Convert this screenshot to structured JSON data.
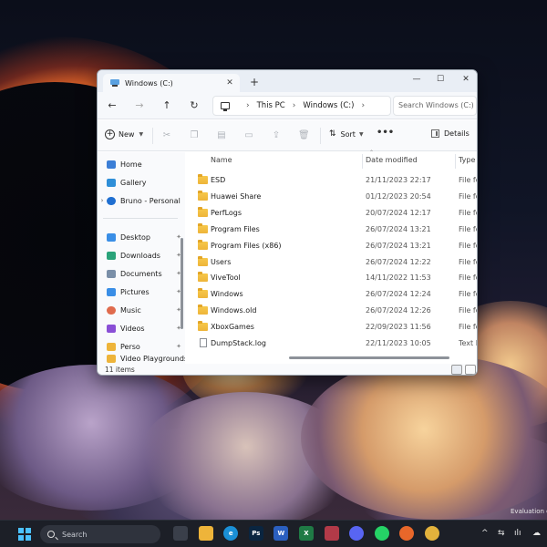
{
  "desktop": {
    "watermark": "Evaluation c"
  },
  "window": {
    "tab_title": "Windows (C:)",
    "new_tab": "+",
    "controls": {
      "minimize": "—",
      "maximize": "☐",
      "close": "✕"
    },
    "nav": {
      "back": "←",
      "forward": "→",
      "up": "↑",
      "refresh": "↻"
    },
    "breadcrumb": [
      "This PC",
      "Windows (C:)"
    ],
    "breadcrumb_sep": "›",
    "search_placeholder": "Search Windows (C:)",
    "toolbar": {
      "new_label": "New",
      "sort_label": "Sort",
      "more_label": "•••",
      "details_label": "Details"
    },
    "sidebar": {
      "quick": [
        {
          "label": "Home",
          "icon": "home-icon",
          "color": "#3b7ed6"
        },
        {
          "label": "Gallery",
          "icon": "gallery-icon",
          "color": "#2f8fd8"
        },
        {
          "label": "Bruno - Personal",
          "icon": "onedrive-icon",
          "color": "#1f6fd1"
        }
      ],
      "pinned": [
        {
          "label": "Desktop",
          "icon": "desktop-icon",
          "color": "#3a8ee6"
        },
        {
          "label": "Downloads",
          "icon": "downloads-icon",
          "color": "#2aa37a"
        },
        {
          "label": "Documents",
          "icon": "documents-icon",
          "color": "#7a8fa8"
        },
        {
          "label": "Pictures",
          "icon": "pictures-icon",
          "color": "#3a8ee6"
        },
        {
          "label": "Music",
          "icon": "music-icon",
          "color": "#e06b4d"
        },
        {
          "label": "Videos",
          "icon": "videos-icon",
          "color": "#8a4fd6"
        },
        {
          "label": "Perso",
          "icon": "folder-icon",
          "color": "#eeb43a"
        },
        {
          "label": "Video Playgrounds",
          "icon": "folder-icon",
          "color": "#eeb43a"
        }
      ]
    },
    "columns": {
      "name": "Name",
      "date": "Date modified",
      "type": "Type"
    },
    "files": [
      {
        "name": "ESD",
        "date": "21/11/2023 22:17",
        "type": "File folder",
        "kind": "folder"
      },
      {
        "name": "Huawei Share",
        "date": "01/12/2023 20:54",
        "type": "File folder",
        "kind": "folder"
      },
      {
        "name": "PerfLogs",
        "date": "20/07/2024 12:17",
        "type": "File folder",
        "kind": "folder"
      },
      {
        "name": "Program Files",
        "date": "26/07/2024 13:21",
        "type": "File folder",
        "kind": "folder"
      },
      {
        "name": "Program Files (x86)",
        "date": "26/07/2024 13:21",
        "type": "File folder",
        "kind": "folder"
      },
      {
        "name": "Users",
        "date": "26/07/2024 12:22",
        "type": "File folder",
        "kind": "folder"
      },
      {
        "name": "ViveTool",
        "date": "14/11/2022 11:53",
        "type": "File folder",
        "kind": "folder"
      },
      {
        "name": "Windows",
        "date": "26/07/2024 12:24",
        "type": "File folder",
        "kind": "folder"
      },
      {
        "name": "Windows.old",
        "date": "26/07/2024 12:26",
        "type": "File folder",
        "kind": "folder"
      },
      {
        "name": "XboxGames",
        "date": "22/09/2023 11:56",
        "type": "File folder",
        "kind": "folder"
      },
      {
        "name": "DumpStack.log",
        "date": "22/11/2023 10:05",
        "type": "Text Document",
        "kind": "file"
      }
    ],
    "status": "11 items"
  },
  "taskbar": {
    "search_label": "Search",
    "apps": [
      {
        "name": "task-view",
        "color": "#3a3f4a",
        "glyph": ""
      },
      {
        "name": "file-explorer",
        "color": "#eeb43a",
        "glyph": ""
      },
      {
        "name": "edge",
        "color": "#1a8fd6",
        "glyph": "e"
      },
      {
        "name": "photoshop",
        "color": "#0a2540",
        "glyph": "Ps"
      },
      {
        "name": "word",
        "color": "#2b5fbf",
        "glyph": "W"
      },
      {
        "name": "excel",
        "color": "#1f7a45",
        "glyph": "X"
      },
      {
        "name": "app-store",
        "color": "#b23a48",
        "glyph": ""
      },
      {
        "name": "discord",
        "color": "#5865f2",
        "glyph": ""
      },
      {
        "name": "whatsapp",
        "color": "#25d366",
        "glyph": ""
      },
      {
        "name": "firefox",
        "color": "#e8672a",
        "glyph": ""
      },
      {
        "name": "chrome",
        "color": "#e3b23c",
        "glyph": ""
      }
    ],
    "tray": [
      "^",
      "⇆",
      "ılı",
      "☁"
    ]
  }
}
